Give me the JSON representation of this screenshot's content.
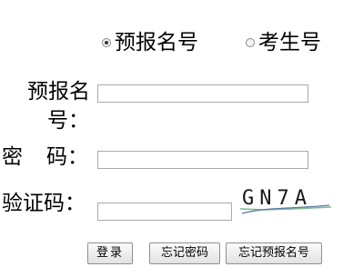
{
  "login_type": {
    "option_id": "预报名号",
    "option_exam": "考生号",
    "selected": "预报名号"
  },
  "labels": {
    "id_line1": "预报名",
    "id_line2": "号：",
    "pw_a": "密",
    "pw_b": "码：",
    "captcha": "验证码："
  },
  "captcha_text": "GN7A",
  "buttons": {
    "login": "登录",
    "forgot_password": "忘记密码",
    "forgot_id": "忘记预报名号"
  }
}
